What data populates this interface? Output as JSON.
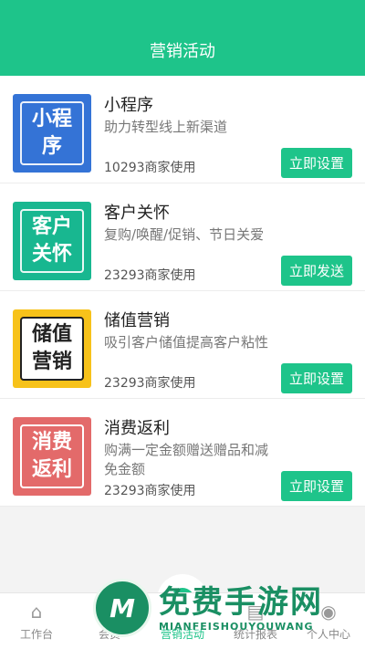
{
  "header": {
    "title": "营销活动"
  },
  "activities": [
    {
      "tile_lines": [
        "小程",
        "序"
      ],
      "title": "小程序",
      "desc": "助力转型线上新渠道",
      "usage": "10293商家使用",
      "button": "立即设置"
    },
    {
      "tile_lines": [
        "客户",
        "关怀"
      ],
      "title": "客户关怀",
      "desc": "复购/唤醒/促销、节日关爱",
      "usage": "23293商家使用",
      "button": "立即发送"
    },
    {
      "tile_lines": [
        "储值",
        "营销"
      ],
      "title": "储值营销",
      "desc": "吸引客户储值提高客户粘性",
      "usage": "23293商家使用",
      "button": "立即设置"
    },
    {
      "tile_lines": [
        "消费",
        "返利"
      ],
      "title": "消费返利",
      "desc": "购满一定金额赠送赠品和减免金额",
      "usage": "23293商家使用",
      "button": "立即设置"
    }
  ],
  "tabbar": {
    "items": [
      {
        "label": "工作台",
        "icon": "home-icon"
      },
      {
        "label": "会员",
        "icon": "member-icon"
      },
      {
        "label": "营销活动",
        "icon": "marketing-icon"
      },
      {
        "label": "统计报表",
        "icon": "report-icon"
      },
      {
        "label": "个人中心",
        "icon": "user-icon"
      }
    ]
  },
  "watermark": {
    "logo_letter": "M",
    "cn": "免费手游网",
    "en": "MIANFEISHOUYOUWANG"
  },
  "colors": {
    "accent": "#1ec48a"
  }
}
